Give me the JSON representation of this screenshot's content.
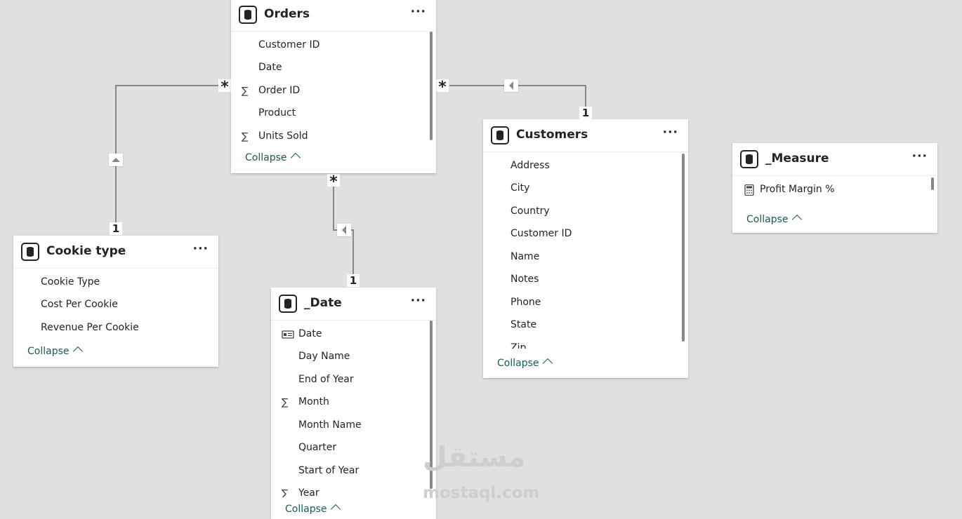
{
  "tables": {
    "orders": {
      "title": "Orders",
      "fields": [
        "Customer ID",
        "Date",
        "Order ID",
        "Product",
        "Units Sold"
      ],
      "icons": [
        "",
        "",
        "sigma-icon",
        "",
        "sigma-icon"
      ],
      "collapse": "Collapse"
    },
    "cookie": {
      "title": "Cookie type",
      "fields": [
        "Cookie Type",
        "Cost Per Cookie",
        "Revenue Per Cookie"
      ],
      "collapse": "Collapse"
    },
    "date": {
      "title": "_Date",
      "fields": [
        "Date",
        "Day Name",
        "End of Year",
        "Month",
        "Month Name",
        "Quarter",
        "Start of Year",
        "Year"
      ],
      "icons": [
        "calendar-icon",
        "",
        "",
        "sigma-icon",
        "",
        "",
        "",
        "sigma-icon"
      ],
      "collapse": "Collapse"
    },
    "customers": {
      "title": "Customers",
      "fields": [
        "Address",
        "City",
        "Country",
        "Customer ID",
        "Name",
        "Notes",
        "Phone",
        "State",
        "Zip"
      ],
      "collapse": "Collapse"
    },
    "measure": {
      "title": "_Measure",
      "fields": [
        "Profit Margin %"
      ],
      "icons": [
        "calculator-icon"
      ],
      "collapse": "Collapse"
    }
  },
  "more_label": "···",
  "relationships": {
    "many": "*",
    "one": "1"
  },
  "watermark": {
    "arabic": "مستقل",
    "latin": "mostaql.com"
  },
  "colors": {
    "background": "#e1e0df",
    "collapse_link": "#1a5c56",
    "relationship_line": "#8a8886"
  }
}
